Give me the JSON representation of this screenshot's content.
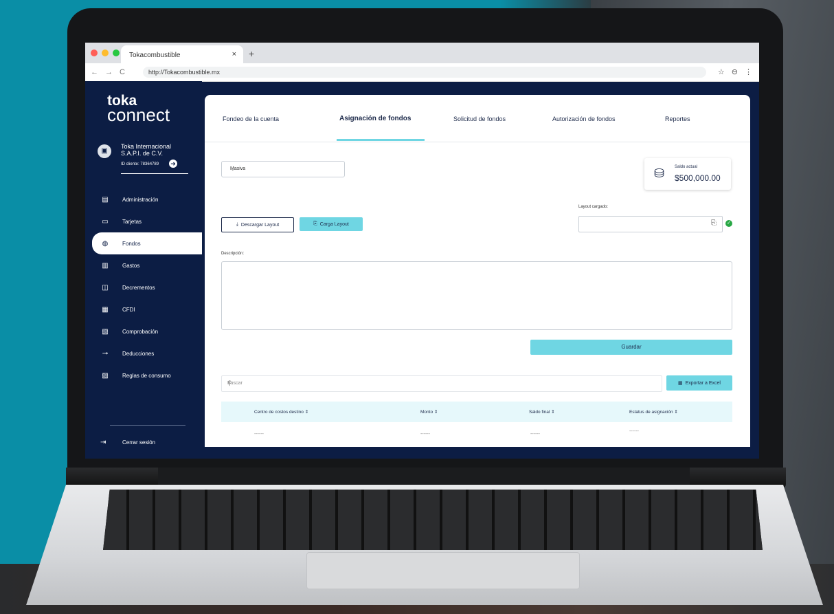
{
  "browser": {
    "tab_title": "Tokacombustible",
    "tab_close": "×",
    "new_tab": "+",
    "nav": [
      "←",
      "→",
      "C"
    ],
    "url": "http://Tokacombustible.mx",
    "right_icons": [
      "☆",
      "⊖",
      "⋮"
    ],
    "dot_colors": [
      "#ff5f57",
      "#febc2e",
      "#28c840"
    ]
  },
  "sidebar": {
    "logo_line1": "toka",
    "logo_line2": "connect",
    "company_name": "Toka Internacional S.A.P.I. de C.V.",
    "client_id": "ID cliente: 78364789",
    "items": [
      {
        "label": "Administración",
        "icon": "building-icon"
      },
      {
        "label": "Tarjetas",
        "icon": "cards-icon"
      },
      {
        "label": "Fondos",
        "icon": "money-bag-icon"
      },
      {
        "label": "Gastos",
        "icon": "expenses-icon"
      },
      {
        "label": "Decrementos",
        "icon": "decrease-icon"
      },
      {
        "label": "CFDI",
        "icon": "document-icon"
      },
      {
        "label": "Comprobación",
        "icon": "receipt-icon"
      },
      {
        "label": "Deducciones",
        "icon": "deduction-icon"
      },
      {
        "label": "Reglas de consumo",
        "icon": "rules-icon"
      }
    ],
    "active_index": 2,
    "logout": "Cerrar sesión"
  },
  "main": {
    "tabs": [
      "Fondeo de la cuenta",
      "Asignación de fondos",
      "Solicitud de fondos",
      "Autorización de fondos",
      "Reportes"
    ],
    "active_tab": 1,
    "select_value": "Masiva",
    "balance_label": "Saldo actual",
    "balance_value": "$500,000.00",
    "download_button": "Descargar Layout",
    "upload_button": "Carga Layout",
    "layout_label": "Layout cargado:",
    "description_label": "Descripción:",
    "save_button": "Guardar",
    "search_placeholder": "Buscar",
    "export_button": "Exportar a Excel",
    "table": {
      "columns": [
        "Centro de costos destino",
        "Monto",
        "Saldo final",
        "Estatus de asignación"
      ],
      "rows": [
        [
          "------",
          "------",
          "------",
          "------"
        ]
      ]
    }
  },
  "colors": {
    "navy": "#0c1d44",
    "accent": "#6fd6e3",
    "success": "#28a745"
  }
}
